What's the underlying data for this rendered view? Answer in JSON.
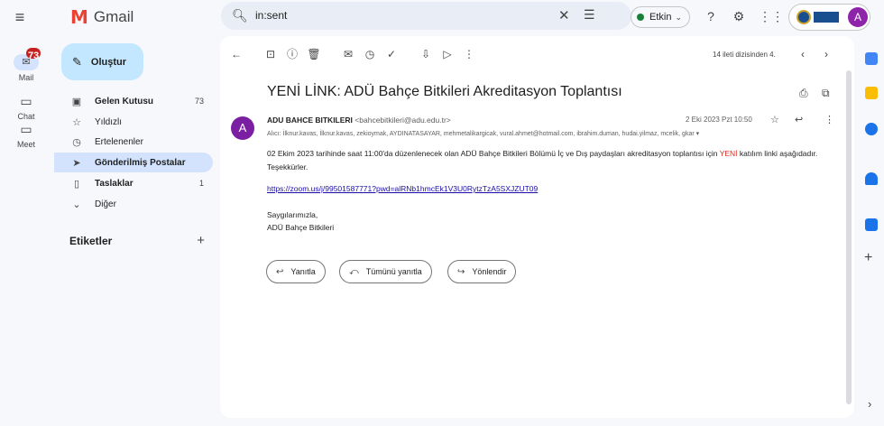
{
  "app": {
    "name": "Gmail"
  },
  "search": {
    "query": "in:sent"
  },
  "status": {
    "label": "Etkin"
  },
  "account": {
    "initial": "A",
    "org_text": "ADNAN MENDERES"
  },
  "rail": {
    "mail": {
      "label": "Mail",
      "badge": "73"
    },
    "chat": {
      "label": "Chat"
    },
    "meet": {
      "label": "Meet"
    }
  },
  "nav": {
    "compose": "Oluştur",
    "items": [
      {
        "label": "Gelen Kutusu",
        "count": "73"
      },
      {
        "label": "Yıldızlı",
        "count": ""
      },
      {
        "label": "Ertelenenler",
        "count": ""
      },
      {
        "label": "Gönderilmiş Postalar",
        "count": ""
      },
      {
        "label": "Taslaklar",
        "count": "1"
      },
      {
        "label": "Diğer",
        "count": ""
      }
    ],
    "labels_heading": "Etiketler"
  },
  "toolbar": {
    "page_info": "14 ileti dizisinden 4."
  },
  "email": {
    "subject": "YENİ LİNK: ADÜ Bahçe Bitkileri Akreditasyon Toplantısı",
    "sender_initial": "A",
    "sender_name": "ADU BAHCE BITKILERI",
    "sender_email": "<bahcebitkileri@adu.edu.tr>",
    "recipients": "Alıcı: İlknur.kavas, İlknur.kavas, zekioymak, AYDINATASAYAR, mehmetalikargicak, vural.ahmet@hotmail.com, ibrahim.duman, hudai.yilmaz, mcelik, gkar",
    "date": "2 Eki 2023 Pzt 10:50",
    "body_before": "02 Ekim 2023 tarihinde saat 11:00'da düzenlenecek olan ADÜ Bahçe Bitkileri Bölümü İç ve Dış paydaşları akreditasyon toplantısı için ",
    "body_red": "YENİ",
    "body_after": " katılım linki aşağıdadır. Teşekkürler.",
    "link": "https://zoom.us/j/99501587771?pwd=alRNb1hmcEk1V3U0RytzTzA5SXJZUT09",
    "sig_line1": "Saygılarımızla,",
    "sig_line2": "ADÜ Bahçe Bitkileri"
  },
  "actions": {
    "reply": "Yanıtla",
    "reply_all": "Tümünü yanıtla",
    "forward": "Yönlendir"
  },
  "colors": {
    "accent": "#0b57d0",
    "compose_bg": "#c2e7ff",
    "active_nav": "#d3e3fd",
    "badge": "#c5221f",
    "status": "#188038"
  }
}
